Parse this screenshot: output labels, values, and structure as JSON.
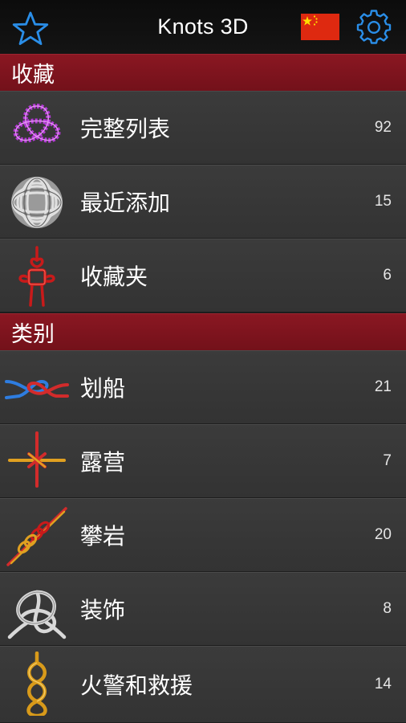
{
  "app": {
    "title": "Knots 3D"
  },
  "nav": {
    "favorite_icon": "star-outline-icon",
    "language_icon": "china-flag-icon",
    "settings_icon": "gear-icon"
  },
  "colors": {
    "accent_blue": "#2a8ee8",
    "section_red": "#7d1420",
    "row_bg": "#383838",
    "flag_red": "#de2910",
    "flag_yellow": "#ffde00"
  },
  "sections": [
    {
      "title": "收藏",
      "rows": [
        {
          "label": "完整列表",
          "count": "92",
          "icon": "purple-trefoil-knot-icon"
        },
        {
          "label": "最近添加",
          "count": "15",
          "icon": "monkey-fist-knot-icon"
        },
        {
          "label": "收藏夹",
          "count": "6",
          "icon": "red-chinese-knot-icon"
        }
      ]
    },
    {
      "title": "类别",
      "rows": [
        {
          "label": "划船",
          "count": "21",
          "icon": "boating-knot-icon"
        },
        {
          "label": "露营",
          "count": "7",
          "icon": "camping-knot-icon"
        },
        {
          "label": "攀岩",
          "count": "20",
          "icon": "climbing-knot-icon"
        },
        {
          "label": "装饰",
          "count": "8",
          "icon": "decorative-knot-icon"
        },
        {
          "label": "火警和救援",
          "count": "14",
          "icon": "rescue-figure-eight-icon"
        }
      ]
    }
  ]
}
